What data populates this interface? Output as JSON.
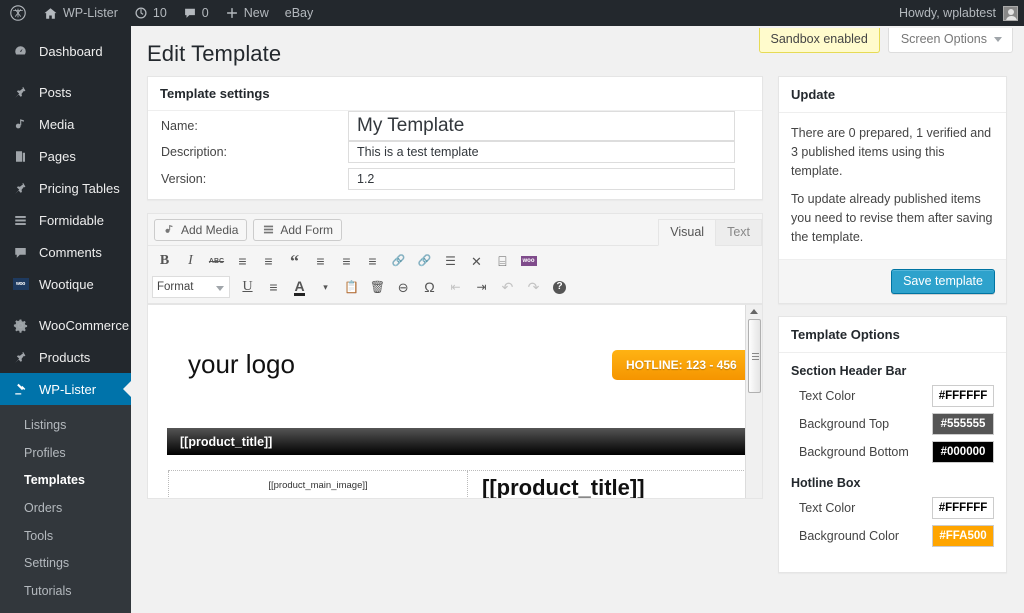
{
  "adminbar": {
    "logo_icon": "wordpress-logo-icon",
    "site_name": "WP-Lister",
    "home_icon": "home-icon",
    "updates_icon": "updates-icon",
    "updates_count": "10",
    "comments_icon": "comment-bubble-icon",
    "comments_count": "0",
    "new_icon": "plus-icon",
    "new_label": "New",
    "ebay_label": "eBay",
    "howdy": "Howdy, wplabtest"
  },
  "sidebar": {
    "items": [
      {
        "label": "Dashboard",
        "icon": "dashboard-icon",
        "current": false
      },
      {
        "label": "Posts",
        "icon": "pin-icon",
        "current": false
      },
      {
        "label": "Media",
        "icon": "media-icon",
        "current": false
      },
      {
        "label": "Pages",
        "icon": "pages-icon",
        "current": false
      },
      {
        "label": "Pricing Tables",
        "icon": "pin-icon",
        "current": false
      },
      {
        "label": "Formidable",
        "icon": "formidable-icon",
        "current": false
      },
      {
        "label": "Comments",
        "icon": "comment-bubble-icon",
        "current": false
      },
      {
        "label": "Wootique",
        "icon": "woo-badge-icon",
        "current": false
      },
      {
        "label": "WooCommerce",
        "icon": "gear-icon",
        "current": false
      },
      {
        "label": "Products",
        "icon": "pin-icon",
        "current": false
      },
      {
        "label": "WP-Lister",
        "icon": "gavel-icon",
        "current": true
      }
    ],
    "submenu": [
      {
        "label": "Listings",
        "current": false
      },
      {
        "label": "Profiles",
        "current": false
      },
      {
        "label": "Templates",
        "current": true
      },
      {
        "label": "Orders",
        "current": false
      },
      {
        "label": "Tools",
        "current": false
      },
      {
        "label": "Settings",
        "current": false
      },
      {
        "label": "Tutorials",
        "current": false
      }
    ]
  },
  "screen_meta": {
    "sandbox_label": "Sandbox enabled",
    "screen_options_label": "Screen Options"
  },
  "page": {
    "title": "Edit Template"
  },
  "template_settings": {
    "box_title": "Template settings",
    "name_label": "Name:",
    "name_value": "My Template",
    "description_label": "Description:",
    "description_value": "This is a test template",
    "version_label": "Version:",
    "version_value": "1.2"
  },
  "editor": {
    "add_media_label": "Add Media",
    "add_form_label": "Add Form",
    "tab_visual": "Visual",
    "tab_text": "Text",
    "format_select": "Format",
    "toolbar_row1": [
      {
        "glyph": "B",
        "name": "bold-icon",
        "dim": false,
        "style": "font-weight:bold;font-family:'Liberation Serif',serif;font-size:14px"
      },
      {
        "glyph": "I",
        "name": "italic-icon",
        "dim": false,
        "style": "font-style:italic;font-family:'Liberation Serif',serif;font-size:14px"
      },
      {
        "glyph": "ABC",
        "name": "strikethrough-icon",
        "dim": false,
        "style": "font-size:7px;text-decoration:line-through;font-weight:bold"
      },
      {
        "glyph": "≡",
        "name": "bulleted-list-icon",
        "dim": false,
        "style": "font-size:14px"
      },
      {
        "glyph": "≡",
        "name": "numbered-list-icon",
        "dim": false,
        "style": "font-size:14px"
      },
      {
        "glyph": "“",
        "name": "blockquote-icon",
        "dim": false,
        "style": "font-size:18px;font-weight:bold;font-family:'Liberation Serif',serif"
      },
      {
        "glyph": "≡",
        "name": "align-left-icon",
        "dim": false,
        "style": "font-size:14px"
      },
      {
        "glyph": "≡",
        "name": "align-center-icon",
        "dim": false,
        "style": "font-size:14px"
      },
      {
        "glyph": "≡",
        "name": "align-right-icon",
        "dim": false,
        "style": "font-size:14px"
      },
      {
        "glyph": "🔗",
        "name": "insert-link-icon",
        "dim": true,
        "style": "font-size:11px"
      },
      {
        "glyph": "🔗",
        "name": "remove-link-icon",
        "dim": true,
        "style": "font-size:11px"
      },
      {
        "glyph": "☰",
        "name": "read-more-icon",
        "dim": false,
        "style": "font-size:12px"
      },
      {
        "glyph": "✕",
        "name": "fullscreen-icon",
        "dim": false,
        "style": "font-size:13px"
      },
      {
        "glyph": "⌸",
        "name": "kitchen-sink-icon",
        "dim": false,
        "style": "font-size:14px"
      },
      {
        "glyph": "woo",
        "name": "woocommerce-shortcode-icon",
        "dim": false,
        "style": "font-size:6px;color:#fff;background:#7f4b8b;padding:2px 2px;font-weight:bold"
      }
    ],
    "toolbar_row2": [
      {
        "glyph": "U",
        "name": "underline-icon",
        "dim": false,
        "style": "text-decoration:underline;font-family:'Liberation Serif',serif;font-size:14px"
      },
      {
        "glyph": "≡",
        "name": "align-justify-icon",
        "dim": false,
        "style": "font-size:14px"
      },
      {
        "glyph": "A",
        "name": "text-color-icon",
        "dim": false,
        "style": "font-weight:bold;font-size:14px;border-bottom:3px solid #222"
      },
      {
        "glyph": "▾",
        "name": "text-color-dropdown-icon",
        "dim": false,
        "style": "font-size:9px;width:11px"
      },
      {
        "glyph": "📋",
        "name": "paste-as-text-icon",
        "dim": false,
        "style": "font-size:12px"
      },
      {
        "glyph": "🗑",
        "name": "paste-from-word-icon",
        "dim": false,
        "style": "font-size:12px"
      },
      {
        "glyph": "⊘",
        "name": "clear-formatting-icon",
        "dim": false,
        "style": "font-size:13px;transform:rotate(45deg)"
      },
      {
        "glyph": "Ω",
        "name": "special-character-icon",
        "dim": false,
        "style": "font-size:14px"
      },
      {
        "glyph": "⇤",
        "name": "outdent-icon",
        "dim": true,
        "style": "font-size:12px"
      },
      {
        "glyph": "⇥",
        "name": "indent-icon",
        "dim": false,
        "style": "font-size:12px"
      },
      {
        "glyph": "↶",
        "name": "undo-icon",
        "dim": true,
        "style": "font-size:14px"
      },
      {
        "glyph": "↷",
        "name": "redo-icon",
        "dim": true,
        "style": "font-size:14px"
      },
      {
        "glyph": "?",
        "name": "keyboard-shortcuts-icon",
        "dim": false,
        "style": "font-size:10px;font-weight:bold;color:#fff;background:#555;border-radius:50%;width:13px;height:13px"
      }
    ],
    "preview": {
      "logo_text": "your  logo",
      "hotline_text": "HOTLINE: 123 - 456",
      "section_bar_text": "[[product_title]]",
      "main_image_placeholder": "[[product_main_image]]",
      "product_title": "[[product_title]]"
    }
  },
  "update_box": {
    "title": "Update",
    "paragraph1": "There are 0 prepared, 1 verified and 3 published items using this template.",
    "paragraph2": "To update already published items you need to revise them after saving the template.",
    "save_label": "Save template"
  },
  "template_options": {
    "title": "Template Options",
    "groups": [
      {
        "name": "Section Header Bar",
        "rows": [
          {
            "label": "Text Color",
            "value": "#FFFFFF",
            "bg": "#FFFFFF",
            "fg": "#000000"
          },
          {
            "label": "Background Top",
            "value": "#555555",
            "bg": "#555555",
            "fg": "#FFFFFF"
          },
          {
            "label": "Background Bottom",
            "value": "#000000",
            "bg": "#000000",
            "fg": "#FFFFFF"
          }
        ]
      },
      {
        "name": "Hotline Box",
        "rows": [
          {
            "label": "Text Color",
            "value": "#FFFFFF",
            "bg": "#FFFFFF",
            "fg": "#000000"
          },
          {
            "label": "Background Color",
            "value": "#FFA500",
            "bg": "#FFA500",
            "fg": "#FFFFFF"
          }
        ]
      }
    ]
  }
}
